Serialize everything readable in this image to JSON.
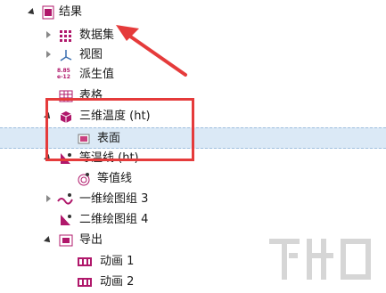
{
  "tree": {
    "results": "结果",
    "datasets": "数据集",
    "views": "视图",
    "derived_values": "派生值",
    "derived_values_icon_text_top": "8.85",
    "derived_values_icon_text_bottom": "e-12",
    "tables": "表格",
    "temp3d": "三维温度 (ht)",
    "surface": "表面",
    "isotherm": "等温线 (ht)",
    "isovalue": "等值线",
    "plot1d3": "一维绘图组 3",
    "plot2d4": "二维绘图组 4",
    "export": "导出",
    "anim1": "动画 1",
    "anim2": "动画 2"
  },
  "colors": {
    "accent": "#b0186b",
    "highlight_border": "#e53b3b",
    "selection_bg": "#dbe9f6"
  },
  "watermark_text": "下载吧"
}
